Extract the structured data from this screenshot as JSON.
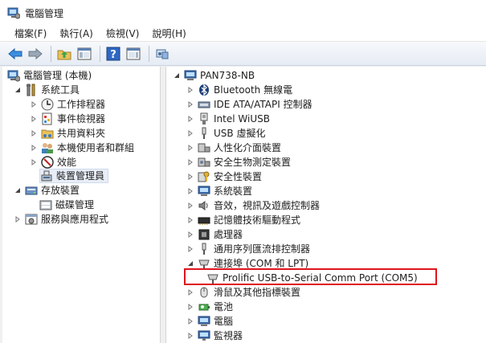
{
  "window": {
    "title": "電腦管理"
  },
  "menu": [
    {
      "label": "檔案(F)"
    },
    {
      "label": "執行(A)"
    },
    {
      "label": "檢視(V)"
    },
    {
      "label": "說明(H)"
    }
  ],
  "toolbar": {
    "buttons": [
      "back-icon",
      "forward-icon",
      "up-folder-icon",
      "show-hide-tree-icon",
      "help-icon",
      "action-pane-icon",
      "properties-icon"
    ]
  },
  "left_tree": [
    {
      "label": "電腦管理 (本機)",
      "icon": "computer-management-icon"
    },
    {
      "label": "系統工具",
      "icon": "tools-icon"
    },
    {
      "label": "工作排程器",
      "icon": "clock-icon"
    },
    {
      "label": "事件檢視器",
      "icon": "event-viewer-icon"
    },
    {
      "label": "共用資料夾",
      "icon": "shared-folder-icon"
    },
    {
      "label": "本機使用者和群組",
      "icon": "users-icon"
    },
    {
      "label": "效能",
      "icon": "performance-icon"
    },
    {
      "label": "裝置管理員",
      "icon": "device-manager-icon"
    },
    {
      "label": "存放裝置",
      "icon": "storage-icon"
    },
    {
      "label": "磁碟管理",
      "icon": "disk-management-icon"
    },
    {
      "label": "服務與應用程式",
      "icon": "services-icon"
    }
  ],
  "right_tree": [
    {
      "label": "PAN738-NB",
      "icon": "computer-icon"
    },
    {
      "label": "Bluetooth 無線電",
      "icon": "bluetooth-icon"
    },
    {
      "label": "IDE ATA/ATAPI 控制器",
      "icon": "ide-controller-icon"
    },
    {
      "label": "Intel WiUSB",
      "icon": "wiusb-icon"
    },
    {
      "label": "USB 虛擬化",
      "icon": "usb-icon"
    },
    {
      "label": "人性化介面裝置",
      "icon": "hid-icon"
    },
    {
      "label": "安全生物測定裝置",
      "icon": "biometric-icon"
    },
    {
      "label": "安全性裝置",
      "icon": "security-key-icon"
    },
    {
      "label": "系統裝置",
      "icon": "system-device-icon"
    },
    {
      "label": "音效，視訊及遊戲控制器",
      "icon": "sound-icon"
    },
    {
      "label": "記憶體技術驅動程式",
      "icon": "memory-icon"
    },
    {
      "label": "處理器",
      "icon": "processor-icon"
    },
    {
      "label": "通用序列匯流排控制器",
      "icon": "usb-controller-icon"
    },
    {
      "label": "連接埠 (COM 和 LPT)",
      "icon": "port-icon"
    },
    {
      "label": "Prolific USB-to-Serial Comm Port (COM5)",
      "icon": "port-icon"
    },
    {
      "label": "滑鼠及其他指標裝置",
      "icon": "mouse-icon"
    },
    {
      "label": "電池",
      "icon": "battery-icon"
    },
    {
      "label": "電腦",
      "icon": "computer-icon"
    },
    {
      "label": "監視器",
      "icon": "monitor-icon"
    }
  ]
}
